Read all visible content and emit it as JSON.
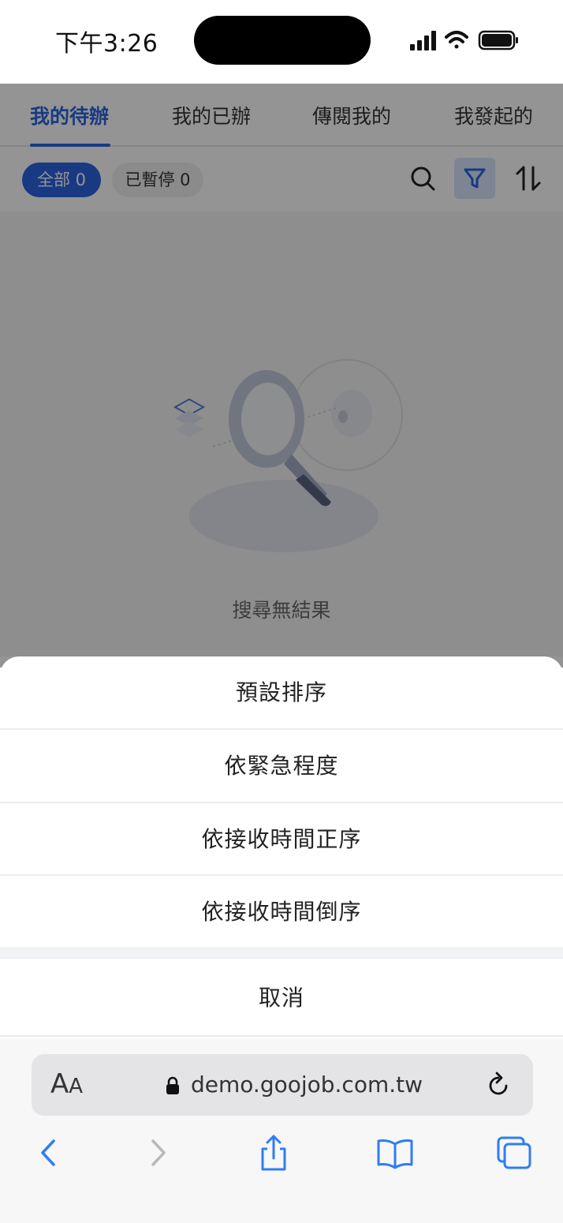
{
  "status_bar": {
    "time": "下午3:26"
  },
  "tabs": [
    {
      "label": "我的待辦",
      "active": true
    },
    {
      "label": "我的已辦",
      "active": false
    },
    {
      "label": "傳閱我的",
      "active": false
    },
    {
      "label": "我發起的",
      "active": false
    }
  ],
  "filters": {
    "all_label": "全部 0",
    "paused_label": "已暫停 0"
  },
  "empty_state": {
    "message": "搜尋無結果"
  },
  "action_sheet": {
    "items": [
      "預設排序",
      "依緊急程度",
      "依接收時間正序",
      "依接收時間倒序"
    ],
    "cancel": "取消"
  },
  "browser": {
    "aa_label": "A",
    "aa_small": "A",
    "url": "demo.goojob.com.tw"
  },
  "colors": {
    "accent": "#2b64e0",
    "overlay": "rgba(0,0,0,0.42)"
  }
}
